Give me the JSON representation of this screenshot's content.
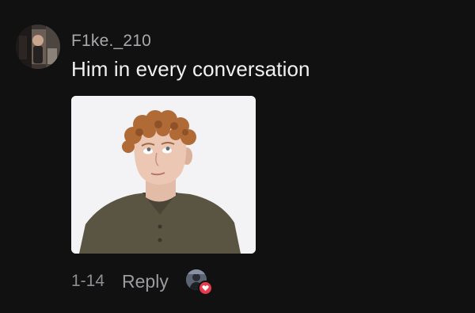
{
  "comment": {
    "username": "F1ke._210",
    "text": "Him in every conversation",
    "timestamp": "1-14",
    "reply_label": "Reply",
    "media": {
      "kind": "gif",
      "subject": "curly-haired young man rolling his eyes"
    },
    "creator_liked": true
  },
  "icons": {
    "avatar": "user-avatar",
    "liked_badge": "heart-icon"
  },
  "colors": {
    "background": "#111112",
    "username": "#a9a9ad",
    "text": "#f1f1f2",
    "meta": "#8e8e93",
    "heart": "#e83a4f"
  }
}
